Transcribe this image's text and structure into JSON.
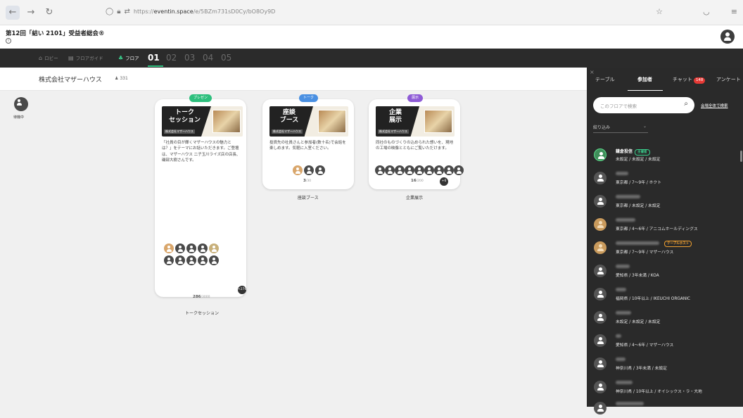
{
  "browser": {
    "url": "https://eventin.space/e/5BZm731sD0Cy/bO8Oy9D",
    "url_host": "eventin.space",
    "url_prefix": "https://",
    "url_path": "/e/5BZm731sD0Cy/bO8Oy9D"
  },
  "event": {
    "title": "第12回「結い 2101」受益者総会®"
  },
  "floor_nav": {
    "lobby": "ロビー",
    "floor_guide": "フロアガイド",
    "floor": "フロア",
    "floors": [
      "01",
      "02",
      "03",
      "04",
      "05"
    ],
    "active_floor": "01"
  },
  "main": {
    "company_name": "株式会社マザーハウス",
    "company_count": "331",
    "user_status": "待機中"
  },
  "tables": [
    {
      "pill": "プレゼン",
      "pill_color": "#2dbf7d",
      "banner_title": "トーク\nセッション",
      "banner_sub": "株式会社マザーハウス",
      "description": "「社員の目が輝くマザーハウスの魅力とは？」をテーマにお話いただきます。ご登壇は、マザーハウス 二子玉川ライズ店の店長、磯部大樹さんです。",
      "count": "286",
      "count_unit": "/3000",
      "more": "+276",
      "name": "トークセッション"
    },
    {
      "pill": "トーク",
      "pill_color": "#4a90e2",
      "banner_title": "座談\nブース",
      "banner_sub": "株式会社マザーハウス",
      "description": "投資先の社員さんと参加者(数十名)で会話を楽しめます。気軽に入室ください。",
      "count": "3",
      "count_unit": "/30",
      "name": "座談ブース"
    },
    {
      "pill": "展示",
      "pill_color": "#8e5bd6",
      "banner_title": "企業\n展示",
      "banner_sub": "株式会社マザーハウス",
      "description": "同社のものづくりの込められた想いを、現地の工場の映像とともにご覧いただけます。",
      "count": "16",
      "count_unit": "/200",
      "more": "+6",
      "name": "企業展示"
    }
  ],
  "panel": {
    "tabs": [
      "テーブル",
      "参加者",
      "チャット",
      "アンケート"
    ],
    "chat_badge": "148",
    "search_placeholder": "このフロアで検索",
    "search_all": "会場全体で検索",
    "filter_label": "絞り込み",
    "participants": [
      {
        "name": "鎌倉投信",
        "tag": "主催者",
        "info": "未設定 / 未設定 / 未設定"
      },
      {
        "info": "東京都 / 7～9年 / ホクト"
      },
      {
        "info": "東京都 / 未設定 / 未設定"
      },
      {
        "info": "東京都 / 4～6年 / アニコムホールディングス"
      },
      {
        "tag": "テーブルホスト",
        "info": "東京都 / 7～9年 / マザーハウス"
      },
      {
        "info": "愛知県 / 3年未満 / KOA"
      },
      {
        "info": "福岡県 / 10年以上 / IKEUCHI ORGANIC"
      },
      {
        "info": "未設定 / 未設定 / 未設定"
      },
      {
        "info": "愛知県 / 4～6年 / マザーハウス"
      },
      {
        "info": "神奈川県 / 3年未満 / 未設定"
      },
      {
        "info": "神奈川県 / 10年以上 / オイシックス・ラ・大地"
      }
    ]
  }
}
